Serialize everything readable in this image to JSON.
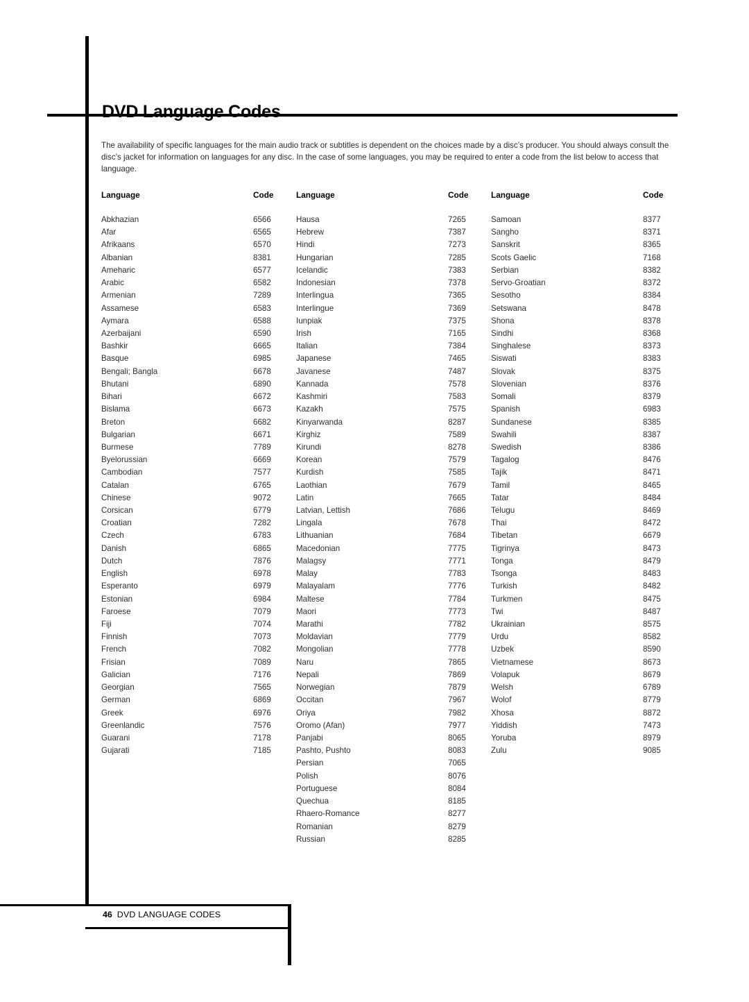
{
  "page": {
    "title": "DVD Language Codes",
    "intro": "The availability of specific languages for the main audio track or subtitles is dependent on the choices made by a disc’s producer. You should always consult the disc’s jacket for information on languages for any disc. In the case of some languages, you may be required to enter a code from the list below to access that language.",
    "footer": {
      "page_number": "46",
      "label": "DVD LANGUAGE CODES"
    },
    "accent_color": "#000000",
    "text_color": "#2d2d2d"
  },
  "table": {
    "headers": {
      "language": "Language",
      "code": "Code"
    },
    "columns": [
      {
        "header_language": "Language",
        "header_code": "Code",
        "rows": [
          {
            "language": "Abkhazian",
            "code": "6566"
          },
          {
            "language": "Afar",
            "code": "6565"
          },
          {
            "language": "Afrikaans",
            "code": "6570"
          },
          {
            "language": "Albanian",
            "code": "8381"
          },
          {
            "language": "Ameharic",
            "code": "6577"
          },
          {
            "language": "Arabic",
            "code": "6582"
          },
          {
            "language": "Armenian",
            "code": "7289"
          },
          {
            "language": "Assamese",
            "code": "6583"
          },
          {
            "language": "Aymara",
            "code": "6588"
          },
          {
            "language": "Azerbaijani",
            "code": "6590"
          },
          {
            "language": "Bashkir",
            "code": "6665"
          },
          {
            "language": "Basque",
            "code": "6985"
          },
          {
            "language": "Bengali; Bangla",
            "code": "6678"
          },
          {
            "language": "Bhutani",
            "code": "6890"
          },
          {
            "language": "Bihari",
            "code": "6672"
          },
          {
            "language": "Bislama",
            "code": "6673"
          },
          {
            "language": "Breton",
            "code": "6682"
          },
          {
            "language": "Bulgarian",
            "code": "6671"
          },
          {
            "language": "Burmese",
            "code": "7789"
          },
          {
            "language": "Byelorussian",
            "code": "6669"
          },
          {
            "language": "Cambodian",
            "code": "7577"
          },
          {
            "language": "Catalan",
            "code": "6765"
          },
          {
            "language": "Chinese",
            "code": "9072"
          },
          {
            "language": "Corsican",
            "code": "6779"
          },
          {
            "language": "Croatian",
            "code": "7282"
          },
          {
            "language": "Czech",
            "code": "6783"
          },
          {
            "language": "Danish",
            "code": "6865"
          },
          {
            "language": "Dutch",
            "code": "7876"
          },
          {
            "language": "English",
            "code": "6978"
          },
          {
            "language": "Esperanto",
            "code": "6979"
          },
          {
            "language": "Estonian",
            "code": "6984"
          },
          {
            "language": "Faroese",
            "code": "7079"
          },
          {
            "language": "Fiji",
            "code": "7074"
          },
          {
            "language": "Finnish",
            "code": "7073"
          },
          {
            "language": "French",
            "code": "7082"
          },
          {
            "language": "Frisian",
            "code": "7089"
          },
          {
            "language": "Galician",
            "code": "7176"
          },
          {
            "language": "Georgian",
            "code": "7565"
          },
          {
            "language": "German",
            "code": "6869"
          },
          {
            "language": "Greek",
            "code": "6976"
          },
          {
            "language": "Greenlandic",
            "code": "7576"
          },
          {
            "language": "Guarani",
            "code": "7178"
          },
          {
            "language": "Gujarati",
            "code": "7185"
          }
        ]
      },
      {
        "header_language": "Language",
        "header_code": "Code",
        "rows": [
          {
            "language": "Hausa",
            "code": "7265"
          },
          {
            "language": "Hebrew",
            "code": "7387"
          },
          {
            "language": "Hindi",
            "code": "7273"
          },
          {
            "language": "Hungarian",
            "code": "7285"
          },
          {
            "language": "Icelandic",
            "code": "7383"
          },
          {
            "language": "Indonesian",
            "code": "7378"
          },
          {
            "language": "Interlingua",
            "code": "7365"
          },
          {
            "language": "Interlingue",
            "code": "7369"
          },
          {
            "language": "Iunpiak",
            "code": "7375"
          },
          {
            "language": "Irish",
            "code": "7165"
          },
          {
            "language": "Italian",
            "code": "7384"
          },
          {
            "language": "Japanese",
            "code": "7465"
          },
          {
            "language": "Javanese",
            "code": "7487"
          },
          {
            "language": "Kannada",
            "code": "7578"
          },
          {
            "language": "Kashmiri",
            "code": "7583"
          },
          {
            "language": "Kazakh",
            "code": "7575"
          },
          {
            "language": "Kinyarwanda",
            "code": "8287"
          },
          {
            "language": "Kirghiz",
            "code": "7589"
          },
          {
            "language": "Kirundi",
            "code": "8278"
          },
          {
            "language": "Korean",
            "code": "7579"
          },
          {
            "language": "Kurdish",
            "code": "7585"
          },
          {
            "language": "Laothian",
            "code": "7679"
          },
          {
            "language": "Latin",
            "code": "7665"
          },
          {
            "language": "Latvian, Lettish",
            "code": "7686"
          },
          {
            "language": "Lingala",
            "code": "7678"
          },
          {
            "language": "Lithuanian",
            "code": "7684"
          },
          {
            "language": "Macedonian",
            "code": "7775"
          },
          {
            "language": "Malagsy",
            "code": "7771"
          },
          {
            "language": "Malay",
            "code": "7783"
          },
          {
            "language": "Malayalam",
            "code": "7776"
          },
          {
            "language": "Maltese",
            "code": "7784"
          },
          {
            "language": "Maori",
            "code": "7773"
          },
          {
            "language": "Marathi",
            "code": "7782"
          },
          {
            "language": "Moldavian",
            "code": "7779"
          },
          {
            "language": "Mongolian",
            "code": "7778"
          },
          {
            "language": "Naru",
            "code": "7865"
          },
          {
            "language": "Nepali",
            "code": "7869"
          },
          {
            "language": "Norwegian",
            "code": "7879"
          },
          {
            "language": "Occitan",
            "code": "7967"
          },
          {
            "language": "Oriya",
            "code": "7982"
          },
          {
            "language": "Oromo (Afan)",
            "code": "7977"
          },
          {
            "language": "Panjabi",
            "code": "8065"
          },
          {
            "language": "Pashto, Pushto",
            "code": "8083"
          },
          {
            "language": "Persian",
            "code": "7065"
          },
          {
            "language": "Polish",
            "code": "8076"
          },
          {
            "language": "Portuguese",
            "code": "8084"
          },
          {
            "language": "Quechua",
            "code": "8185"
          },
          {
            "language": "Rhaero-Romance",
            "code": "8277"
          },
          {
            "language": "Romanian",
            "code": "8279"
          },
          {
            "language": "Russian",
            "code": "8285"
          }
        ]
      },
      {
        "header_language": "Language",
        "header_code": "Code",
        "rows": [
          {
            "language": "Samoan",
            "code": "8377"
          },
          {
            "language": "Sangho",
            "code": "8371"
          },
          {
            "language": "Sanskrit",
            "code": "8365"
          },
          {
            "language": "Scots Gaelic",
            "code": "7168"
          },
          {
            "language": "Serbian",
            "code": "8382"
          },
          {
            "language": "Servo-Groatian",
            "code": "8372"
          },
          {
            "language": "Sesotho",
            "code": "8384"
          },
          {
            "language": "Setswana",
            "code": "8478"
          },
          {
            "language": "Shona",
            "code": "8378"
          },
          {
            "language": "Sindhi",
            "code": "8368"
          },
          {
            "language": "Singhalese",
            "code": "8373"
          },
          {
            "language": "Siswati",
            "code": "8383"
          },
          {
            "language": "Slovak",
            "code": "8375"
          },
          {
            "language": "Slovenian",
            "code": "8376"
          },
          {
            "language": "Somali",
            "code": "8379"
          },
          {
            "language": "Spanish",
            "code": "6983"
          },
          {
            "language": "Sundanese",
            "code": "8385"
          },
          {
            "language": "Swahili",
            "code": "8387"
          },
          {
            "language": "Swedish",
            "code": "8386"
          },
          {
            "language": "Tagalog",
            "code": "8476"
          },
          {
            "language": "Tajik",
            "code": "8471"
          },
          {
            "language": "Tamil",
            "code": "8465"
          },
          {
            "language": "Tatar",
            "code": "8484"
          },
          {
            "language": "Telugu",
            "code": "8469"
          },
          {
            "language": "Thai",
            "code": "8472"
          },
          {
            "language": "Tibetan",
            "code": "6679"
          },
          {
            "language": "Tigrinya",
            "code": "8473"
          },
          {
            "language": "Tonga",
            "code": "8479"
          },
          {
            "language": "Tsonga",
            "code": "8483"
          },
          {
            "language": "Turkish",
            "code": "8482"
          },
          {
            "language": "Turkmen",
            "code": "8475"
          },
          {
            "language": "Twi",
            "code": "8487"
          },
          {
            "language": "Ukrainian",
            "code": "8575"
          },
          {
            "language": "Urdu",
            "code": "8582"
          },
          {
            "language": "Uzbek",
            "code": "8590"
          },
          {
            "language": "Vietnamese",
            "code": "8673"
          },
          {
            "language": "Volapuk",
            "code": "8679"
          },
          {
            "language": "Welsh",
            "code": "6789"
          },
          {
            "language": "Wolof",
            "code": "8779"
          },
          {
            "language": "Xhosa",
            "code": "8872"
          },
          {
            "language": "Yiddish",
            "code": "7473"
          },
          {
            "language": "Yoruba",
            "code": "8979"
          },
          {
            "language": "Zulu",
            "code": "9085"
          }
        ]
      }
    ]
  }
}
